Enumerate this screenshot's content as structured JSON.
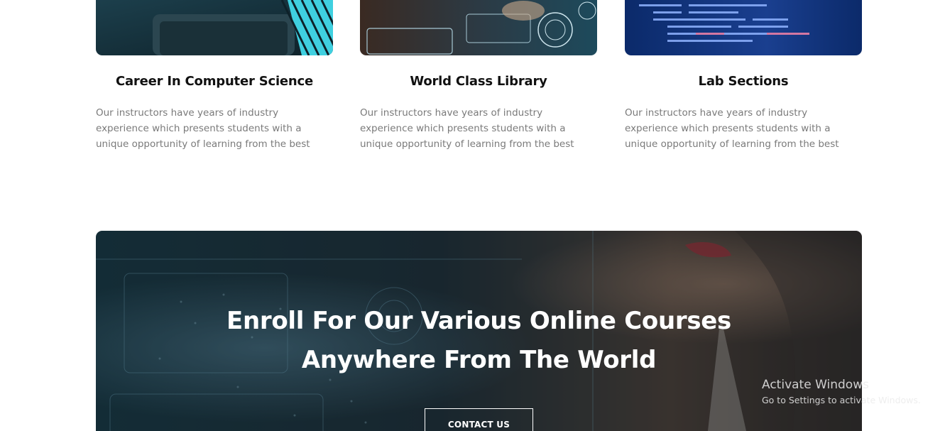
{
  "features": [
    {
      "title": "Career In Computer Science",
      "description": "Our instructors have years of industry experience which presents students with a unique opportunity of learning from the best"
    },
    {
      "title": "World Class Library",
      "description": "Our instructors have years of industry experience which presents students with a unique opportunity of learning from the best"
    },
    {
      "title": "Lab Sections",
      "description": "Our instructors have years of industry experience which presents students with a unique opportunity of learning from the best"
    }
  ],
  "banner": {
    "heading_line1": "Enroll For Our Various Online Courses",
    "heading_line2": "Anywhere From The World",
    "button_label": "CONTACT US"
  },
  "watermark": {
    "title": "Activate Windows",
    "subtitle": "Go to Settings to activate Windows."
  },
  "colors": {
    "heading": "#111111",
    "body_text": "#7a7a7a",
    "banner_overlay": "#0d2430",
    "accent_cyan": "#3fd0e0"
  }
}
